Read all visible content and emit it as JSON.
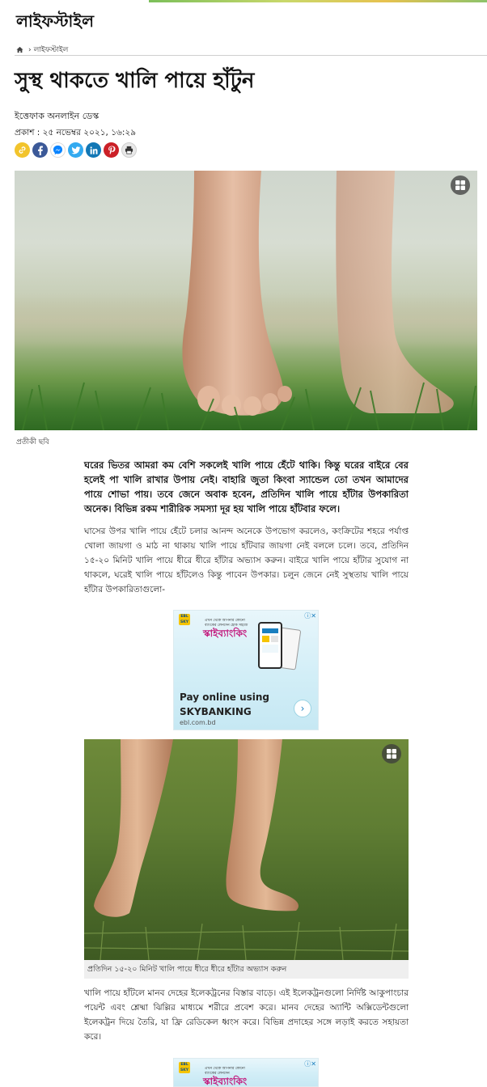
{
  "section": {
    "name": "লাইফস্টাইল"
  },
  "breadcrumb": {
    "home_icon": "home-icon",
    "separator": "›",
    "current": "লাইফস্টাইল"
  },
  "article": {
    "headline": "সুস্থ থাকতে খালি পায়ে হাঁটুন",
    "byline": "ইত্তেফাক অনলাইন ডেস্ক",
    "published": "প্রকাশ : ২৫ নভেম্বর ২০২১, ১৬:২৯",
    "lead_caption": "প্রতীকী ছবি",
    "lead_paragraph": "ঘরের ভিতর আমরা কম বেশি সকলেই খালি পায়ে হেঁটে থাকি। কিন্তু ঘরের বাইরে বের হলেই পা খালি রাখার উপায় নেই। বাহারি জুতা কিংবা স্যান্ডেল তো তখন আমাদের পায়ে শোভা পায়। তবে জেনে অবাক হবেন, প্রতিদিন খালি পায়ে হাঁটার উপকারিতা অনেক। বিভিন্ন রকম শারীরিক সমস্যা দূর হয় খালি পায়ে হাঁটবার ফলে।",
    "paragraph_1": "ঘাসের উপর খালি পায়ে হেঁটে চলার আনন্দ অনেকে উপভোগ করলেও, কংক্রিটের শহরে পর্যাপ্ত খোলা জায়গা ও মাঠ না থাকায় খালি পায়ে হাঁটবার জায়গা নেই বললে চলে। তবে, প্রতিদিন ১৫-২০ মিনিট খালি পায়ে ধীরে ধীরে হাঁটার অভ্যাস করুন। বাইরে খালি পায়ে হাঁটার সুযোগ না থাকলে, ঘরেই খালি পায়ে হাঁটলেও কিন্তু পাবেন উপকার। চলুন জেনে নেই সুস্থতায় খালি পায়ে হাঁটার উপকারিতাগুলো-",
    "photo_2_caption": "প্রতিদিন ১৫-২০ মিনিট খালি পায়ে ধীরে ধীরে হাঁটার অভ্যাস করুন",
    "paragraph_2": "খালি পায়ে হাঁটলে মানব দেহের ইলেকট্রনের বিস্তার বাড়ে। এই ইলেকট্রনগুলো নির্দিষ্ট আকুপাংচার পয়েন্ট এবং শ্লেষ্মা ঝিল্লির মাধ্যমে শরীরে প্রবেশ করে। মানব দেহের অ্যান্টি অক্সিডেন্টগুলো ইলেকট্রন দিয়ে তৈরি, যা ফ্রি রেডিকেল ধ্বংস করে। বিভিন্ন প্রদাহের সঙ্গে লড়াই করতে সহায়তা করে।"
  },
  "share_icons": [
    "link-icon",
    "facebook-icon",
    "messenger-icon",
    "twitter-icon",
    "linkedin-icon",
    "pinterest-icon",
    "print-icon"
  ],
  "ad_1": {
    "logo_text": "EBL SKY",
    "small_text": "এখন থেকে আপনার কোনো ব্যাংকের লেনদেন হোক সহজে",
    "brand": "স্কাইব্যাংকিং",
    "headline_line_1": "Pay online using",
    "headline_line_2": "SKYBANKING",
    "domain": "ebl.com.bd",
    "close": "ⓘ✕"
  },
  "ad_2": {
    "logo_text": "EBL SKY",
    "small_text": "এখন থেকে আপনার কোনো ব্যাংকের লেনদেন",
    "brand": "স্কাইব্যাংকিং",
    "close": "ⓘ✕"
  },
  "colors": {
    "accent_link": "#f2c42c",
    "facebook": "#3b5998",
    "twitter": "#33aaf0",
    "linkedin": "#1277b5",
    "pinterest": "#cb2027",
    "ad_brand": "#c2187c"
  }
}
